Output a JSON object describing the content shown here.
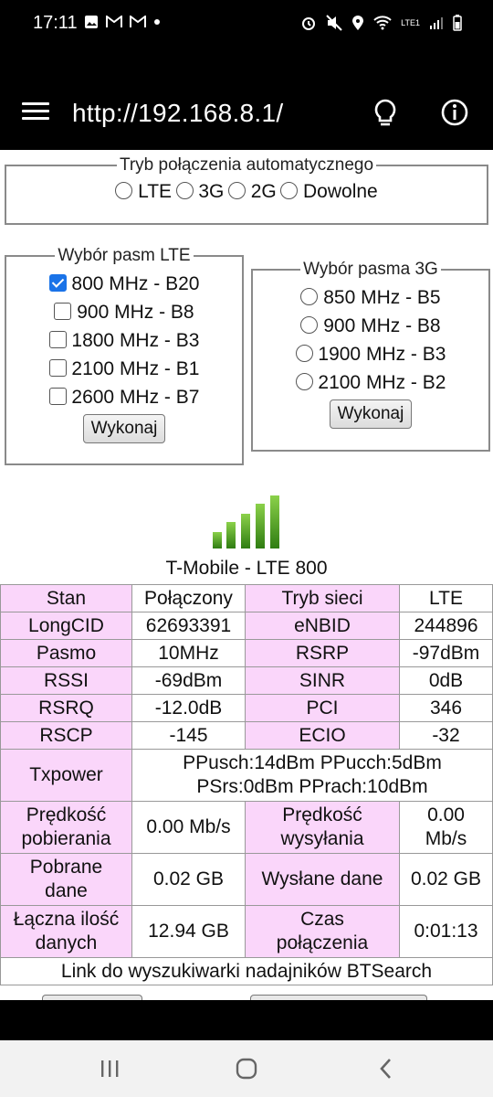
{
  "status_bar": {
    "time": "17:11",
    "network": "LTE1"
  },
  "app_bar": {
    "url": "http://192.168.8.1/"
  },
  "connection_mode": {
    "legend": "Tryb połączenia automatycznego",
    "options": [
      "LTE",
      "3G",
      "2G",
      "Dowolne"
    ]
  },
  "lte_bands": {
    "legend": "Wybór pasm LTE",
    "items": [
      {
        "label": "800 MHz - B20",
        "checked": true
      },
      {
        "label": "900 MHz - B8",
        "checked": false
      },
      {
        "label": "1800 MHz - B3",
        "checked": false
      },
      {
        "label": "2100 MHz - B1",
        "checked": false
      },
      {
        "label": "2600 MHz - B7",
        "checked": false
      }
    ],
    "button": "Wykonaj"
  },
  "bands_3g": {
    "legend": "Wybór pasma 3G",
    "items": [
      "850 MHz - B5",
      "900 MHz - B8",
      "1900 MHz - B3",
      "2100 MHz - B2"
    ],
    "button": "Wykonaj"
  },
  "signal": {
    "bars": 5,
    "color": "#4a9e1c"
  },
  "operator": "T-Mobile - LTE 800",
  "table": {
    "stan_label": "Stan",
    "stan": "Połączony",
    "tryb_label": "Tryb sieci",
    "tryb": "LTE",
    "longcid_label": "LongCID",
    "longcid": "62693391",
    "enbid_label": "eNBID",
    "enbid": "244896",
    "pasmo_label": "Pasmo",
    "pasmo": "10MHz",
    "rsrp_label": "RSRP",
    "rsrp": "-97dBm",
    "rssi_label": "RSSI",
    "rssi": "-69dBm",
    "sinr_label": "SINR",
    "sinr": "0dB",
    "rsrq_label": "RSRQ",
    "rsrq": "-12.0dB",
    "pci_label": "PCI",
    "pci": "346",
    "rscp_label": "RSCP",
    "rscp": "-145",
    "ecio_label": "ECIO",
    "ecio": "-32",
    "txpower_label": "Txpower",
    "txpower_line1": "PPusch:14dBm PPucch:5dBm",
    "txpower_line2": "PSrs:0dBm PPrach:10dBm",
    "dl_speed_label_1": "Prędkość",
    "dl_speed_label_2": "pobierania",
    "dl_speed": "0.00 Mb/s",
    "ul_speed_label_1": "Prędkość",
    "ul_speed_label_2": "wysyłania",
    "ul_speed_1": "0.00",
    "ul_speed_2": "Mb/s",
    "downloaded_label_1": "Pobrane",
    "downloaded_label_2": "dane",
    "downloaded": "0.02 GB",
    "uploaded_label": "Wysłane dane",
    "uploaded": "0.02 GB",
    "total_label_1": "Łączna ilość",
    "total_label_2": "danych",
    "total": "12.94 GB",
    "time_label_1": "Czas",
    "time_label_2": "połączenia",
    "time": "0:01:13",
    "bts_link": "Link do wyszukiwarki nadajników BTSearch"
  }
}
